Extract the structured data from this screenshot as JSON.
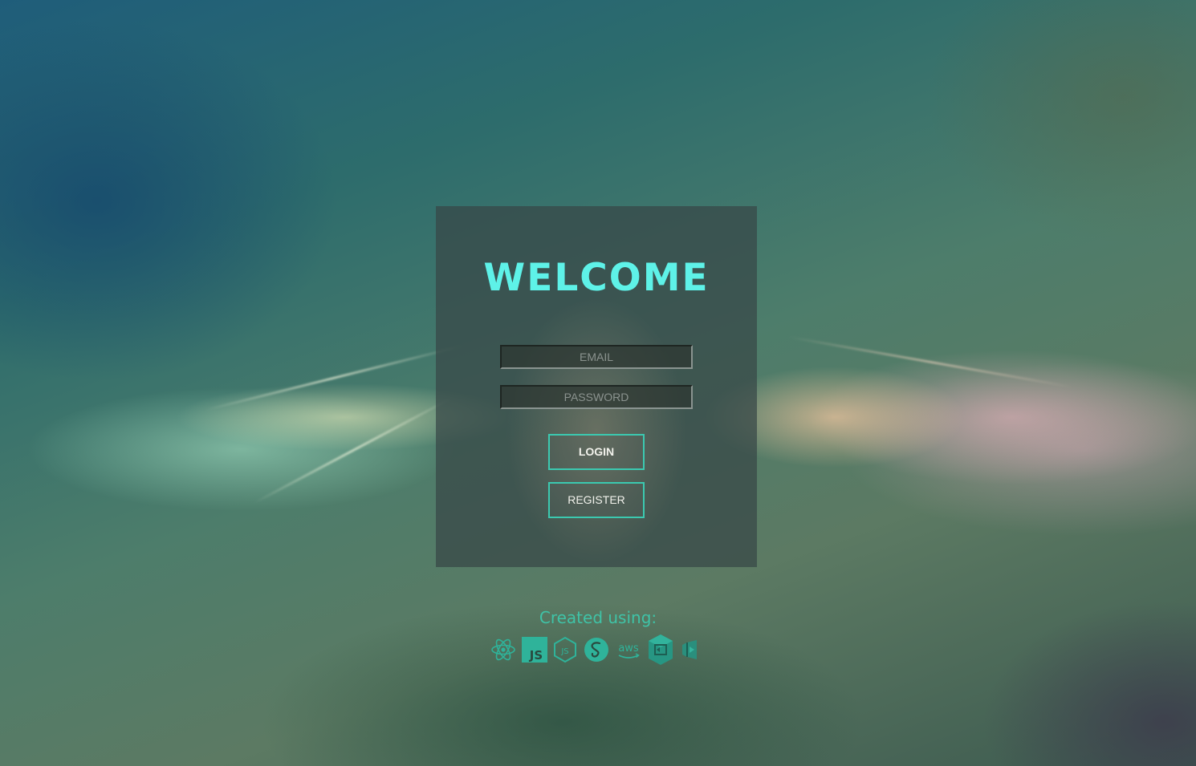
{
  "login_card": {
    "title": "WELCOME",
    "email_placeholder": "EMAIL",
    "password_placeholder": "PASSWORD",
    "login_label": "LOGIN",
    "register_label": "REGISTER"
  },
  "footer": {
    "created_label": "Created using:",
    "tech_icons": [
      "react-icon",
      "javascript-icon",
      "nodejs-icon",
      "sass-icon",
      "aws-icon",
      "dynamodb-icon",
      "visual-studio-icon"
    ],
    "aws_text": "aws",
    "js_text": "JS"
  },
  "colors": {
    "title": "#5ef2e8",
    "accent": "#3bc9b0",
    "footer": "#3fc3a7"
  }
}
